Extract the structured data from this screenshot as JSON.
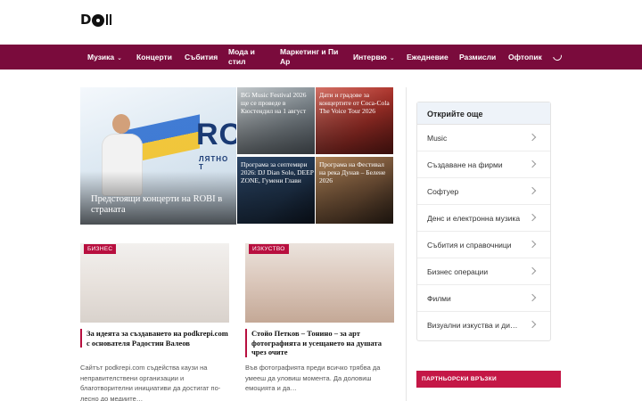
{
  "brand": {
    "logo_text": "DⓄN",
    "accent": "#7a0b3c",
    "category_color": "#b80f3f"
  },
  "nav": {
    "items": [
      {
        "label": "Музика",
        "dropdown": true
      },
      {
        "label": "Концерти",
        "dropdown": false
      },
      {
        "label": "Събития",
        "dropdown": false
      },
      {
        "label": "Мода и стил",
        "dropdown": false
      },
      {
        "label": "Маркетинг и Пи Ар",
        "dropdown": false
      },
      {
        "label": "Интервю",
        "dropdown": true
      },
      {
        "label": "Ежедневие",
        "dropdown": false
      },
      {
        "label": "Размисли",
        "dropdown": false
      },
      {
        "label": "Офтопик",
        "dropdown": false
      }
    ],
    "chevron": "⌄",
    "theme_toggle_icon": "moon-icon"
  },
  "featured": {
    "main": {
      "title": "Предстоящи концерти на ROBI в страната",
      "poster_name": "ROBI",
      "poster_sub": "ЛЯТНО Т"
    },
    "tiles": [
      {
        "title": "BG Music Festival 2026 ще се проведе в Кюстендил на 1 август"
      },
      {
        "title": "Дати и градове за концертите от Coca-Cola The Voice Tour 2026"
      },
      {
        "title": "Програма за септември 2026: DJ Dian Solo, DEEP ZONE, Гумени Глави"
      },
      {
        "title": "Програма на Фестивал на река Дунав – Белене 2026"
      }
    ]
  },
  "cards": [
    {
      "category": "БИЗНЕС",
      "title": "За идеята за създаването на podkrepi.com с основателя Радостин Валеов",
      "excerpt": "Сайтът podkrepi.com съдейства каузи на неправителствени организации и благотворителни инициативи да достигат по-лесно до медиите…"
    },
    {
      "category": "ИЗКУСТВО",
      "title": "Стойо Петков – Тонино – за арт фотографията и усещането на душата чрез очите",
      "excerpt": "Във фотографията преди всичко трябва да умееш да уловиш момента. Да доловиш емоцията и да…"
    }
  ],
  "sidebar": {
    "heading": "Открийте още",
    "items": [
      {
        "label": "Music"
      },
      {
        "label": "Създаване на фирми"
      },
      {
        "label": "Софтуер"
      },
      {
        "label": "Денс и електронна музика"
      },
      {
        "label": "Събития и справочници"
      },
      {
        "label": "Бизнес операции"
      },
      {
        "label": "Филми"
      },
      {
        "label": "Визуални изкуства и дизайн"
      }
    ],
    "partner_heading": "ПАРТНЬОРСКИ ВРЪЗКИ"
  }
}
